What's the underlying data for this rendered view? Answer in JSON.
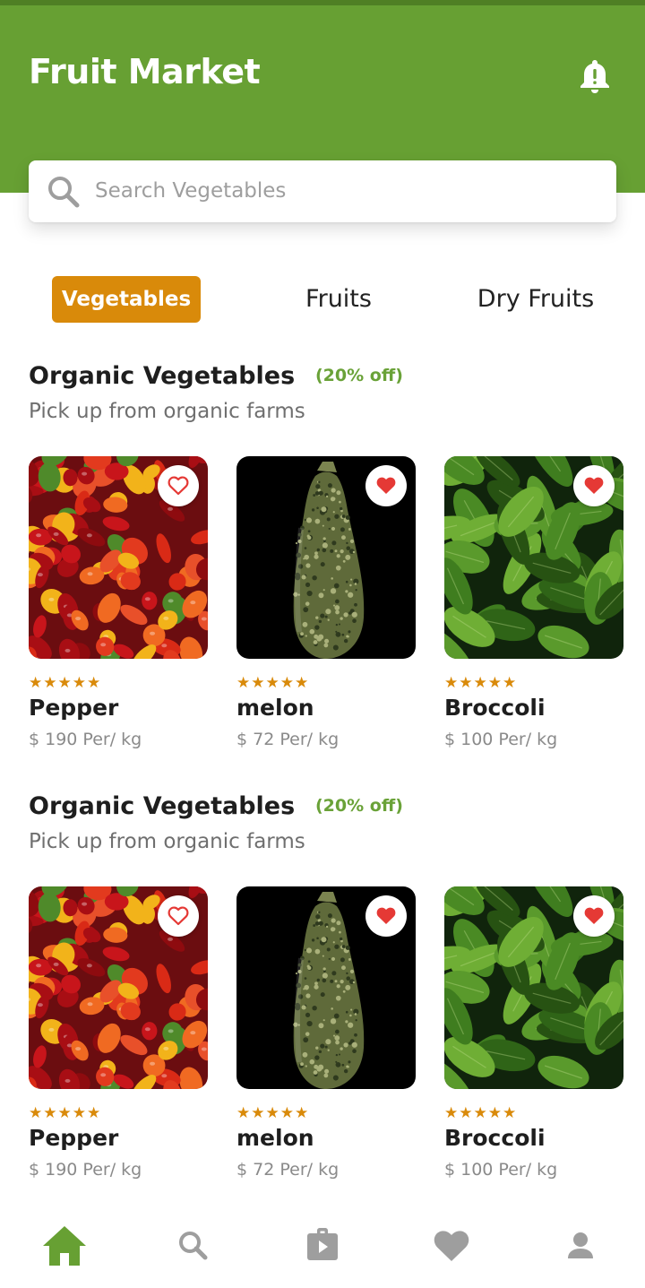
{
  "app": {
    "title": "Fruit Market"
  },
  "search": {
    "placeholder": "Search Vegetables",
    "value": ""
  },
  "tabs": [
    {
      "label": "Vegetables",
      "active": true
    },
    {
      "label": "Fruits",
      "active": false
    },
    {
      "label": "Dry Fruits",
      "active": false
    }
  ],
  "sections": [
    {
      "title": "Organic Vegetables",
      "discount": "(20% off)",
      "subtitle": "Pick up from organic farms",
      "products": [
        {
          "name": "Pepper",
          "price": "$ 190 Per/ kg",
          "stars": "★★★★★",
          "favorite": false,
          "image": "peppers"
        },
        {
          "name": "melon",
          "price": "$ 72 Per/ kg",
          "stars": "★★★★★",
          "favorite": true,
          "image": "melon"
        },
        {
          "name": "Broccoli",
          "price": "$ 100 Per/ kg",
          "stars": "★★★★★",
          "favorite": true,
          "image": "greens"
        }
      ]
    },
    {
      "title": "Organic Vegetables",
      "discount": "(20% off)",
      "subtitle": "Pick up from organic farms",
      "products": [
        {
          "name": "Pepper",
          "price": "$ 190 Per/ kg",
          "stars": "★★★★★",
          "favorite": false,
          "image": "peppers"
        },
        {
          "name": "melon",
          "price": "$ 72 Per/ kg",
          "stars": "★★★★★",
          "favorite": true,
          "image": "melon"
        },
        {
          "name": "Broccoli",
          "price": "$ 100 Per/ kg",
          "stars": "★★★★★",
          "favorite": true,
          "image": "greens"
        }
      ]
    }
  ],
  "bottom_nav": [
    {
      "icon": "home-icon",
      "active": true
    },
    {
      "icon": "search-icon",
      "active": false
    },
    {
      "icon": "shopping-bag-icon",
      "active": false
    },
    {
      "icon": "heart-icon",
      "active": false
    },
    {
      "icon": "person-icon",
      "active": false
    }
  ],
  "colors": {
    "header": "#67a033",
    "accent": "#d98a0a",
    "discount": "#6aa238",
    "heart": "#e53935",
    "nav_active": "#67a033",
    "nav_inactive": "#9e9e9e"
  }
}
